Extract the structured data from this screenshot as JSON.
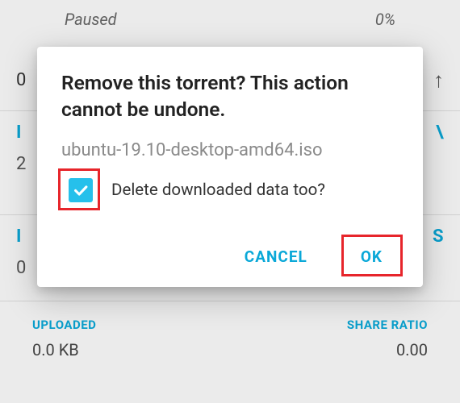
{
  "background": {
    "status_label": "Paused",
    "progress": "0%",
    "left_zero": "0",
    "partial_left": "I",
    "partial_right": "\\",
    "cut_left": "2",
    "cut_small": "I",
    "cut_zero": "0",
    "cut_right": "S",
    "uploaded_label": "UPLOADED",
    "uploaded_value": "0.0 KB",
    "ratio_label": "SHARE RATIO",
    "ratio_value": "0.00"
  },
  "dialog": {
    "title": "Remove this torrent? This action cannot be undone.",
    "filename": "ubuntu-19.10-desktop-amd64.iso",
    "checkbox_label": "Delete downloaded data too?",
    "checkbox_checked": true,
    "cancel_label": "CANCEL",
    "ok_label": "OK"
  }
}
